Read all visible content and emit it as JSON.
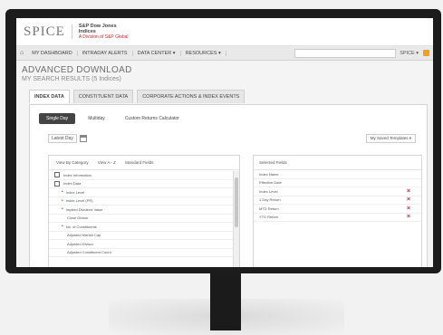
{
  "brand": {
    "logo": "SPICE",
    "sp_line1": "S&P Dow Jones",
    "sp_line2": "Indices",
    "sp_line3": "A Division of S&P Global"
  },
  "nav": {
    "items": [
      "MY DASHBOARD",
      "INTRADAY ALERTS",
      "DATA CENTER ▾",
      "RESOURCES ▾"
    ],
    "user": "SPICE ▾"
  },
  "page": {
    "title": "ADVANCED DOWNLOAD",
    "subtitle": "MY SEARCH RESULTS (5 Indices)"
  },
  "tabs": [
    "INDEX DATA",
    "CONSTITUENT DATA",
    "CORPORATE ACTIONS & INDEX EVENTS"
  ],
  "subtabs": [
    "Single Day",
    "Multiday",
    "Custom Returns Calculator"
  ],
  "date": {
    "label": "Latest Day"
  },
  "template": {
    "label": "My Saved Templates ▾"
  },
  "view": {
    "by_category": "View By Category",
    "a_z": "View A - Z",
    "standard": "Standard Fields"
  },
  "tree": [
    {
      "label": "Index Information",
      "kind": "box"
    },
    {
      "label": "Index Data",
      "kind": "box"
    },
    {
      "label": "Index Level",
      "kind": "bullet"
    },
    {
      "label": "Index Level (PR)",
      "kind": "bullet"
    },
    {
      "label": "Implied Dividend Value",
      "kind": "bullet"
    },
    {
      "label": "Close Divisor",
      "kind": "plain"
    },
    {
      "label": "No. of Constituents",
      "kind": "bullet"
    },
    {
      "label": "Adjusted Market Cap",
      "kind": "plain"
    },
    {
      "label": "Adjusted Divisor",
      "kind": "plain"
    },
    {
      "label": "Adjusted Constituent Count",
      "kind": "plain"
    }
  ],
  "selected": {
    "header": "Selected Fields",
    "items": [
      "Index Name",
      "Effective Date",
      "Index Level",
      "1 Day Return",
      "MTD Return",
      "YTD Return"
    ]
  }
}
